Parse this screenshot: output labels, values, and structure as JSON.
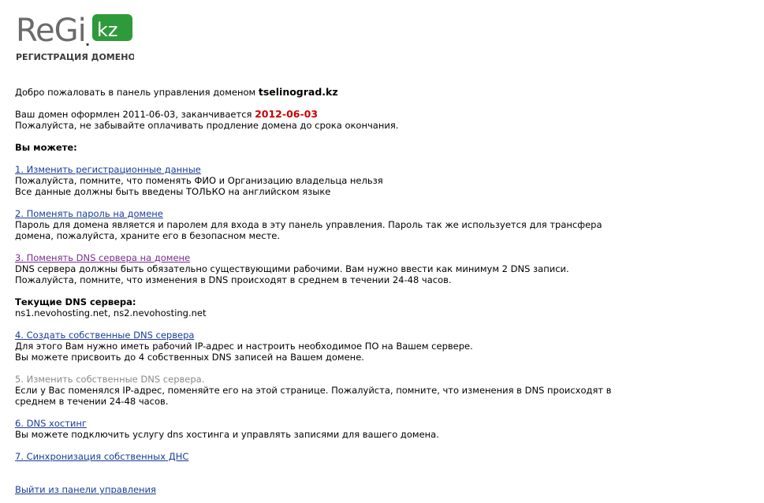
{
  "logo": {
    "wordmark": "ReGi",
    "badge": "kz",
    "dot": ".",
    "tagline": "РЕГИСТРАЦИЯ ДОМЕНОВ",
    "colors": {
      "gray": "#6b6b6b",
      "green": "#2e9a3a",
      "dark": "#3a3a3a"
    }
  },
  "welcome": {
    "text": "Добро пожаловать в панель управления доменом ",
    "domain": "tselinograd.kz"
  },
  "registration": {
    "prefix": "Ваш домен оформлен 2011-06-03, заканчивается ",
    "expires": "2012-06-03",
    "reminder": "Пожалуйста, не забывайте оплачивать продление домена до срока окончания."
  },
  "you_can": "Вы можете:",
  "actions": [
    {
      "link": "1. Изменить регистрационные данные",
      "lines": [
        "Пожалуйста, помните, что поменять ФИО и Организацию владельца нельзя",
        "Все данные должны быть введены ТОЛЬКО на английском языке"
      ]
    },
    {
      "link": "2. Поменять пароль на домене",
      "lines": [
        "Пароль для домена является и паролем для входа в эту панель управления. Пароль так же используется для трансфера домена, пожалуйста, храните его в безопасном месте."
      ]
    },
    {
      "link": "3. Поменять DNS сервера на домене",
      "lines": [
        "DNS сервера должны быть обязательно существующими рабочими. Вам нужно ввести как минимум 2 DNS записи.",
        "Пожалуйста, помните, что изменения в DNS происходят в среднем в течении 24-48 часов."
      ]
    },
    {
      "link": "4. Создать собственные DNS сервера ",
      "lines": [
        "Для этого Вам нужно иметь рабочий IP-адрес и настроить необходимое ПО на Вашем сервере.",
        "Вы можете присвоить до 4 собственных DNS записей на Вашем домене."
      ]
    },
    {
      "link": "5. Изменить собственные DNS сервера.",
      "lines": [
        "Если у Вас поменялся IP-адрес, поменяйте его на этой странице. Пожалуйста, помните, что изменения в DNS происходят в среднем в течении 24-48 часов."
      ]
    },
    {
      "link": "6. DNS хостинг",
      "lines": [
        "Вы можете подключить услугу dns хостинга и управлять записями для вашего домена."
      ]
    },
    {
      "link": "7. Синхронизация собственных ДНС",
      "lines": []
    }
  ],
  "current_dns": {
    "title": "Текущие DNS сервера:",
    "value": "ns1.nevohosting.net, ns2.nevohosting.net"
  },
  "logout": "Выйти из панели управления",
  "colors": {
    "link": "#1a3d99",
    "visited_link": "#7b2d8e",
    "disabled_link": "#8a8a8a",
    "expire_date": "#cc0000"
  }
}
